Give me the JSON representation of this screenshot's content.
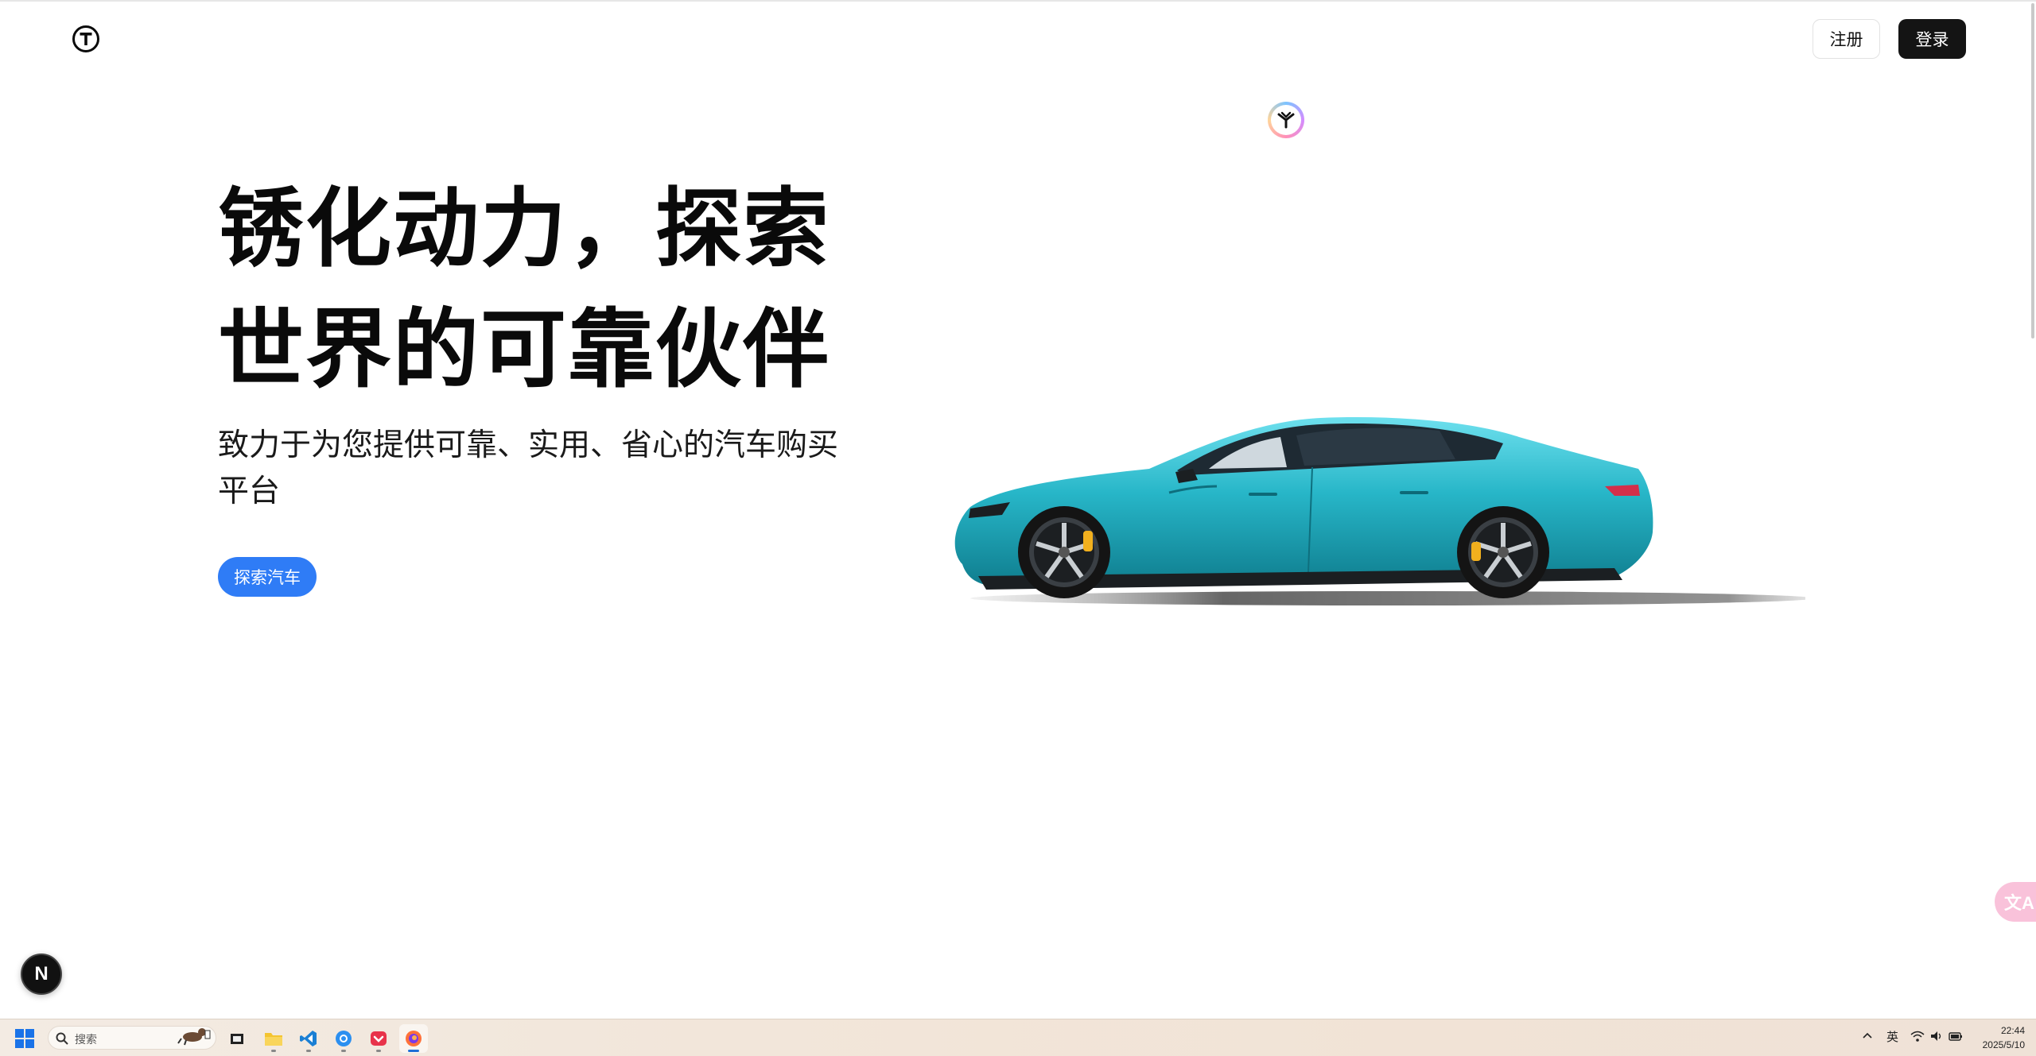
{
  "header": {
    "logo_letter": "T",
    "register_label": "注册",
    "login_label": "登录"
  },
  "hero": {
    "title_line1": "锈化动力，探索",
    "title_line2": "世界的可靠伙伴",
    "subtitle": "致力于为您提供可靠、实用、省心的汽车购买平台",
    "cta_label": "探索汽车"
  },
  "widgets": {
    "next_badge": "N",
    "translate_glyph": "文A"
  },
  "taskbar": {
    "search_placeholder": "搜索",
    "apps": [
      "file-explorer",
      "vscode",
      "browser-blue",
      "app-red",
      "firefox"
    ],
    "tray_language": "英",
    "time": "22:44",
    "date": "2025/5/10"
  },
  "colors": {
    "primary_button": "#2f7cf6",
    "login_button": "#141414",
    "car_body": "#27b6c8"
  }
}
